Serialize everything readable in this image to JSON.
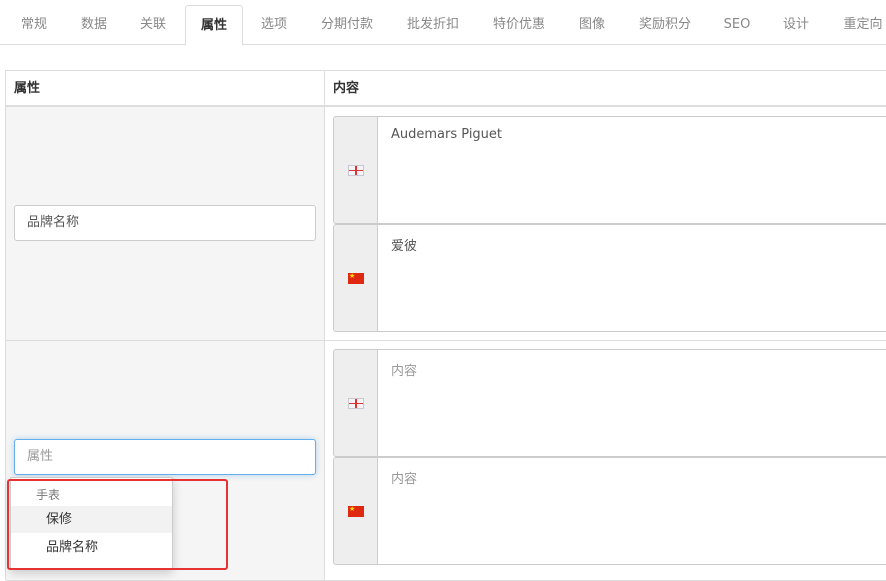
{
  "tabs": [
    {
      "label": "常规"
    },
    {
      "label": "数据"
    },
    {
      "label": "关联"
    },
    {
      "label": "属性"
    },
    {
      "label": "选项"
    },
    {
      "label": "分期付款"
    },
    {
      "label": "批发折扣"
    },
    {
      "label": "特价优惠"
    },
    {
      "label": "图像"
    },
    {
      "label": "奖励积分"
    },
    {
      "label": "SEO"
    },
    {
      "label": "设计"
    },
    {
      "label": "重定向"
    }
  ],
  "active_tab": "属性",
  "table": {
    "headers": {
      "attribute": "属性",
      "content": "内容"
    },
    "rows": [
      {
        "attribute_value": "品牌名称",
        "contents": [
          {
            "lang": "english-flag-icon",
            "value": "Audemars Piguet"
          },
          {
            "lang": "china-flag-icon",
            "value": "爱彼"
          }
        ]
      },
      {
        "attribute_placeholder": "属性",
        "contents": [
          {
            "lang": "english-flag-icon",
            "placeholder": "内容"
          },
          {
            "lang": "china-flag-icon",
            "placeholder": "内容"
          }
        ]
      }
    ]
  },
  "autocomplete": {
    "group_header": "手表",
    "items": [
      "保修",
      "品牌名称"
    ]
  },
  "colors": {
    "highlight_border": "#e53333",
    "focus_border": "#66afe9"
  }
}
